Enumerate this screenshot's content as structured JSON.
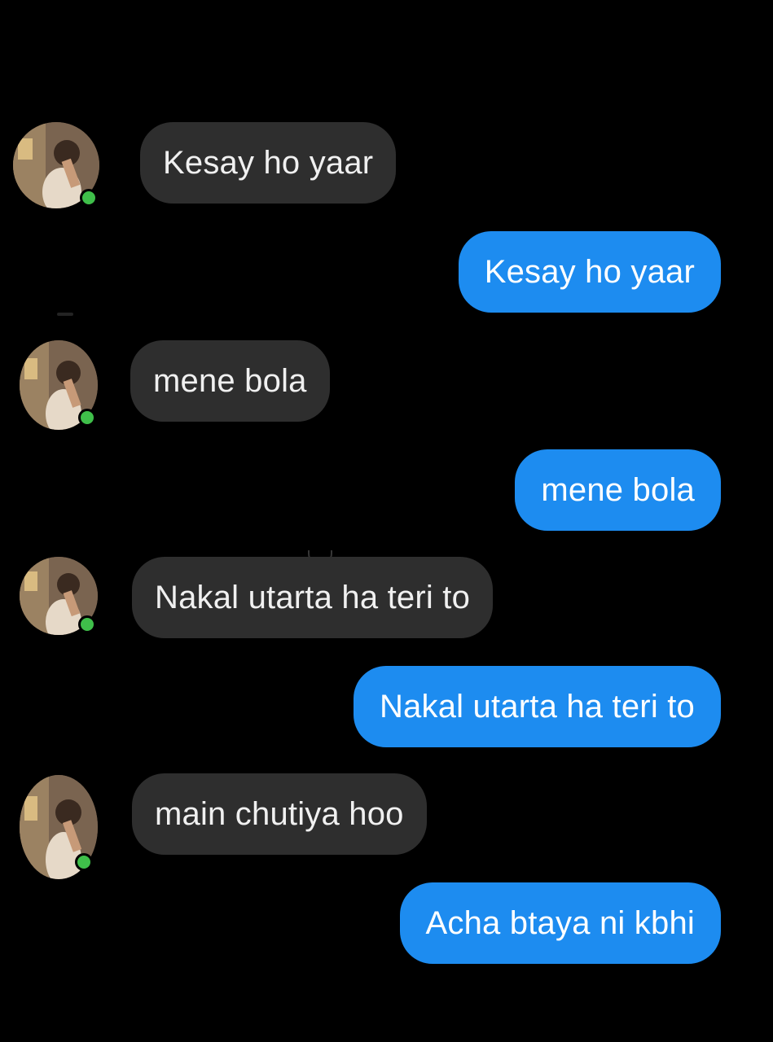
{
  "conversation": {
    "messages": [
      {
        "direction": "incoming",
        "text": "Kesay ho yaar",
        "avatar": "contact-avatar",
        "online": true
      },
      {
        "direction": "outgoing",
        "text": "Kesay ho yaar"
      },
      {
        "direction": "incoming",
        "text": "mene bola",
        "avatar": "contact-avatar",
        "online": true
      },
      {
        "direction": "outgoing",
        "text": "mene bola"
      },
      {
        "direction": "incoming",
        "text": "Nakal utarta ha teri to",
        "avatar": "contact-avatar",
        "online": true
      },
      {
        "direction": "outgoing",
        "text": "Nakal utarta ha teri to"
      },
      {
        "direction": "incoming",
        "text": "main chutiya hoo",
        "avatar": "contact-avatar",
        "online": true
      },
      {
        "direction": "outgoing",
        "text": "Acha btaya ni kbhi"
      }
    ]
  },
  "colors": {
    "background": "#000000",
    "incoming_bubble": "#2e2e2e",
    "outgoing_bubble": "#1d8cf0",
    "online_indicator": "#3fbf4a"
  }
}
